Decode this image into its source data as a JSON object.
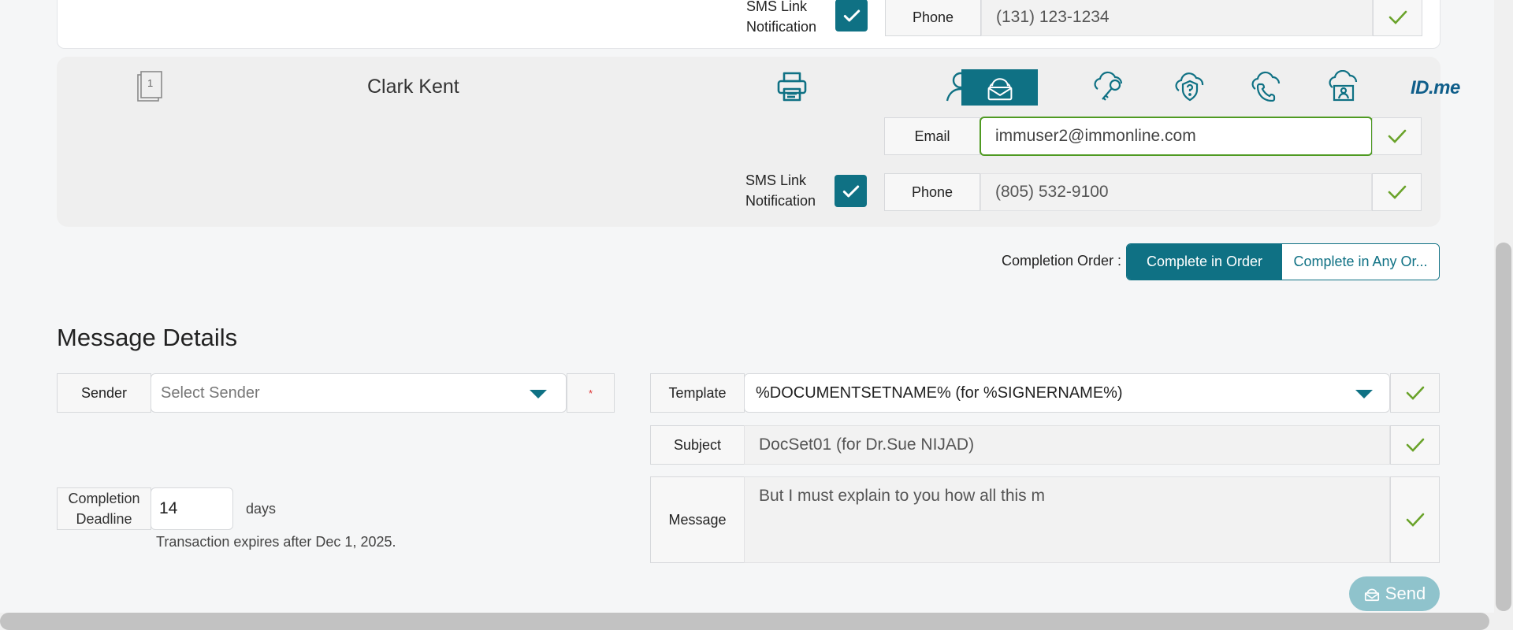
{
  "signer_prev": {
    "sms_label": "SMS Link Notification",
    "phone_label": "Phone",
    "phone_value": "(131) 123-1234"
  },
  "signer": {
    "order_number": "1",
    "name": "Clark Kent",
    "auth_methods": [
      "person-icon",
      "mail-icon",
      "key-cloud-icon",
      "question-shield-icon",
      "phone-cloud-icon",
      "id-cloud-icon"
    ],
    "idme_label": "ID.me",
    "email_label": "Email",
    "email_value": "immuser2@immonline.com",
    "sms_label": "SMS Link Notification",
    "phone_label": "Phone",
    "phone_value": "(805) 532-9100"
  },
  "completion_order": {
    "label": "Completion Order :",
    "options": [
      "Complete in Order",
      "Complete in Any Or..."
    ],
    "selected": "Complete in Order"
  },
  "message_details": {
    "title": "Message Details",
    "sender_label": "Sender",
    "sender_placeholder": "Select Sender",
    "required_mark": "*",
    "template_label": "Template",
    "template_value": "%DOCUMENTSETNAME% (for %SIGNERNAME%)",
    "subject_label": "Subject",
    "subject_value": "DocSet01 (for Dr.Sue NIJAD)",
    "message_label": "Message",
    "message_value": "But I must explain to you how all this m",
    "deadline_label": "Completion Deadline",
    "deadline_value": "14",
    "deadline_unit": "days",
    "expiry_note": "Transaction expires after Dec 1, 2025."
  },
  "send_label": "Send",
  "colors": {
    "accent": "#0f7184",
    "check": "#6aa32a",
    "email_border": "#4f9a22"
  }
}
